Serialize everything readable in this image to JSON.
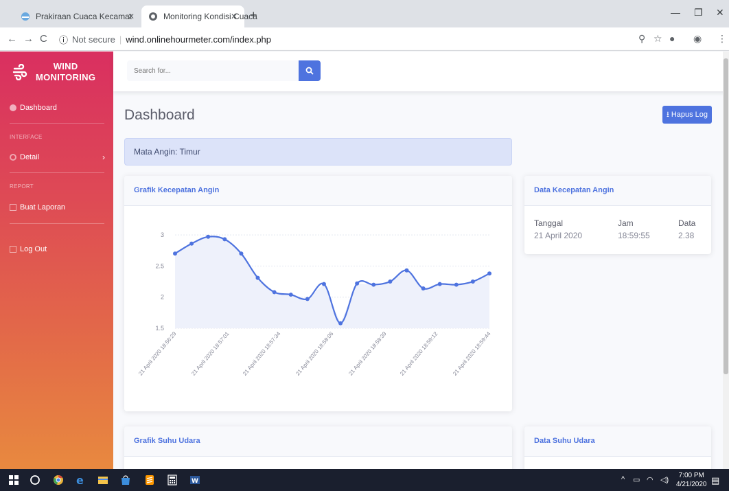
{
  "browser": {
    "tabs": [
      {
        "label": "Prakiraan Cuaca Kecamatan Gres"
      },
      {
        "label": "Monitoring Kondisi Cuaca"
      }
    ],
    "not_secure": "Not secure",
    "url": "wind.onlinehourmeter.com/index.php"
  },
  "sidebar": {
    "brand_line1": "WIND",
    "brand_line2": "MONITORING",
    "items": [
      {
        "label": "Dashboard"
      },
      {
        "heading": "INTERFACE"
      },
      {
        "label": "Detail"
      },
      {
        "heading": "REPORT"
      },
      {
        "label": "Buat Laporan"
      },
      {
        "label": "Log Out"
      }
    ]
  },
  "topbar": {
    "search_placeholder": "Search for..."
  },
  "main": {
    "title": "Dashboard",
    "hapus_label": "Hapus Log",
    "alert": "Mata Angin: Timur"
  },
  "cards": {
    "chart_title": "Grafik Kecepatan Angin",
    "speed_title": "Data Kecepatan Angin",
    "speed_table": {
      "headers": [
        "Tanggal",
        "Jam",
        "Data"
      ],
      "row": [
        "21 April 2020",
        "18:59:55",
        "2.38"
      ]
    },
    "temp_chart_title": "Grafik Suhu Udara",
    "temp_title": "Data Suhu Udara"
  },
  "chart_data": {
    "type": "line",
    "title": "Grafik Kecepatan Angin",
    "xlabel": "",
    "ylabel": "",
    "ylim": [
      1.5,
      3.1
    ],
    "yticks": [
      1.5,
      2,
      2.5,
      3
    ],
    "ytick_labels": [
      "1.5",
      "2",
      "2.5",
      "3"
    ],
    "xtick_labels": [
      "21 April 2020 18:56:29",
      "21 April 2020 18:57:01",
      "21 April 2020 18:57:34",
      "21 April 2020 18:58:06",
      "21 April 2020 18:58:39",
      "21 April 2020 18:59:12",
      "21 April 2020 18:59:44"
    ],
    "values": [
      2.7,
      2.86,
      2.97,
      2.93,
      2.7,
      2.31,
      2.08,
      2.04,
      1.97,
      2.21,
      1.58,
      2.22,
      2.2,
      2.25,
      2.43,
      2.14,
      2.21,
      2.2,
      2.25,
      2.38
    ],
    "color": "#4e73df",
    "fill": "#eef1fb",
    "grid": true
  },
  "taskbar": {
    "time": "7:00 PM",
    "date": "4/21/2020"
  },
  "colors": {
    "primary": "#4e73df",
    "sidebar_top": "#d92f60",
    "sidebar_bottom": "#e8893f"
  }
}
